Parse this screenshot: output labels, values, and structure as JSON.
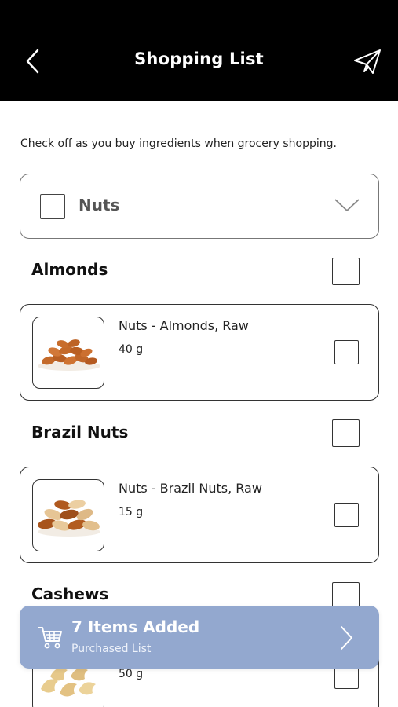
{
  "header": {
    "title": "Shopping List",
    "back_icon": "chevron-left-icon",
    "send_icon": "paper-plane-icon"
  },
  "intro_text": "Check off as you buy ingredients when grocery shopping.",
  "category": {
    "label": "Nuts",
    "checked": false,
    "expand_icon": "chevron-down-icon"
  },
  "groups": [
    {
      "title": "Almonds",
      "checked": false,
      "items": [
        {
          "name": "Nuts - Almonds, Raw",
          "quantity": "40 g",
          "image": "almonds-image",
          "checked": false
        }
      ]
    },
    {
      "title": "Brazil Nuts",
      "checked": false,
      "items": [
        {
          "name": "Nuts - Brazil Nuts, Raw",
          "quantity": "15 g",
          "image": "brazil-nuts-image",
          "checked": false
        }
      ]
    },
    {
      "title": "Cashews",
      "checked": false,
      "items": [
        {
          "name": "",
          "quantity": "50 g",
          "image": "cashews-image",
          "checked": false
        }
      ]
    }
  ],
  "banner": {
    "title": "7 Items Added",
    "subtitle": "Purchased List",
    "cart_icon": "cart-icon",
    "arrow_icon": "chevron-right-icon"
  },
  "colors": {
    "header_bg": "#000000",
    "banner_bg": "#93a8cf",
    "nut_almond": "#c46a2a",
    "nut_cashew": "#e8cc8e"
  }
}
